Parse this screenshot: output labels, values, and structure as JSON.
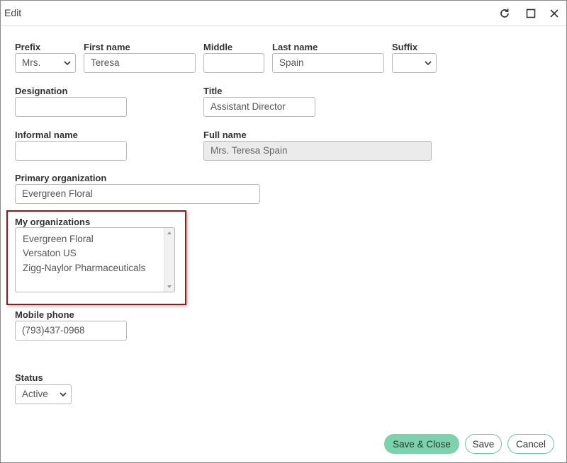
{
  "window": {
    "title": "Edit",
    "icons": [
      "refresh-icon",
      "maximize-icon",
      "close-icon"
    ]
  },
  "form": {
    "prefix": {
      "label": "Prefix",
      "value": "Mrs."
    },
    "first_name": {
      "label": "First name",
      "value": "Teresa"
    },
    "middle": {
      "label": "Middle",
      "value": ""
    },
    "last_name": {
      "label": "Last name",
      "value": "Spain"
    },
    "suffix": {
      "label": "Suffix",
      "value": ""
    },
    "designation": {
      "label": "Designation",
      "value": ""
    },
    "title": {
      "label": "Title",
      "value": "Assistant Director"
    },
    "informal_name": {
      "label": "Informal name",
      "value": ""
    },
    "full_name": {
      "label": "Full name",
      "value": "Mrs. Teresa Spain"
    },
    "primary_organization": {
      "label": "Primary organization",
      "value": "Evergreen Floral"
    },
    "my_organizations": {
      "label": "My organizations",
      "items": [
        "Evergreen Floral",
        "Versaton US",
        "Zigg-Naylor Pharmaceuticals"
      ]
    },
    "mobile_phone": {
      "label": "Mobile phone",
      "value": "(793)437-0968"
    },
    "status": {
      "label": "Status",
      "value": "Active"
    }
  },
  "buttons": {
    "save_close": "Save & Close",
    "save": "Save",
    "cancel": "Cancel"
  },
  "colors": {
    "accent": "#7fd1ad",
    "highlight_border": "#8b1c24"
  }
}
